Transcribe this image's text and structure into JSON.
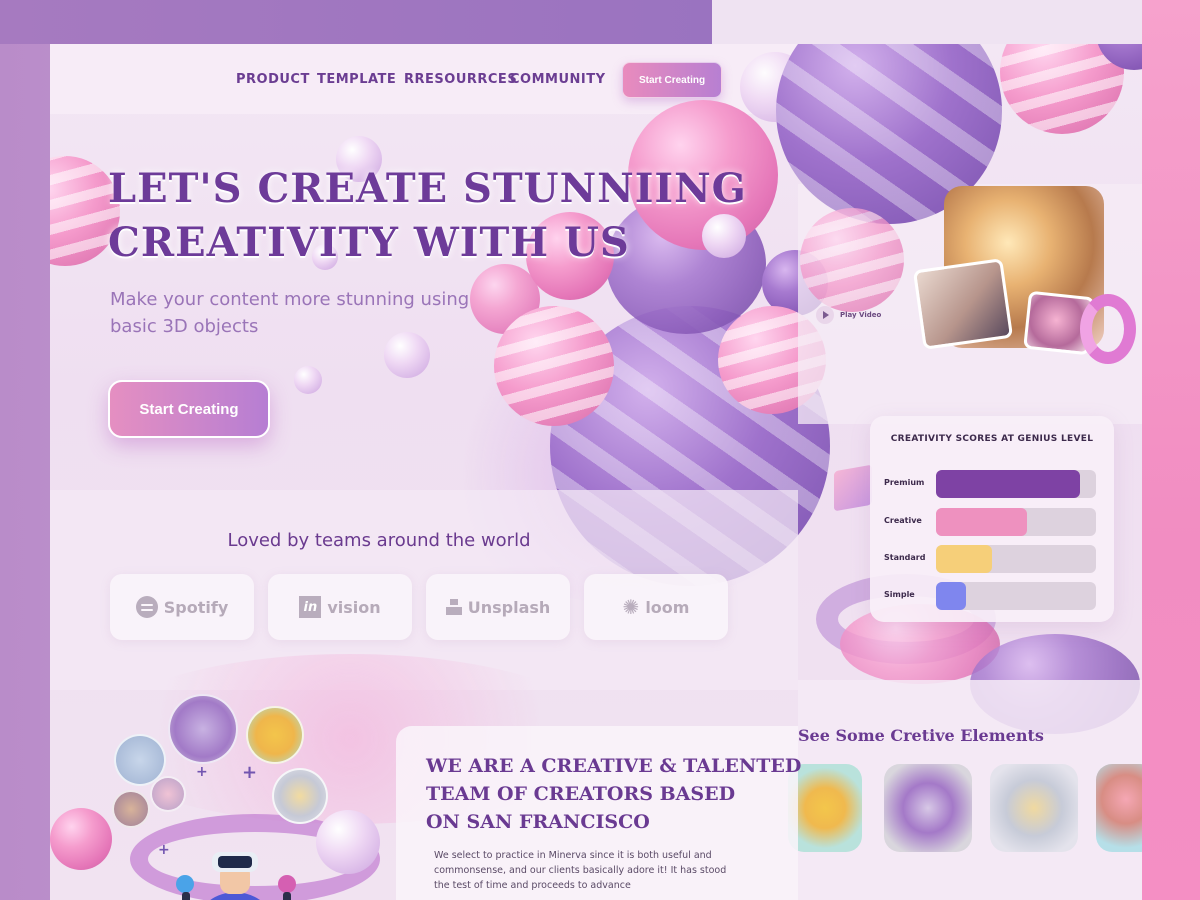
{
  "nav": {
    "items": [
      "PRODUCT",
      "TEMPLATE",
      "RRESOURRCES",
      "COMMUNITY"
    ],
    "cta": "Start Creating"
  },
  "hero": {
    "title_line1": "LET'S CREATE STUNNIING",
    "title_line2": "CREATIVITY WITH US",
    "subtitle_line1": "Make your content more stunning using",
    "subtitle_line2": "basic 3D objects",
    "cta": "Start Creating"
  },
  "video": {
    "play_label": "Play Video",
    "play_icon": "play-icon"
  },
  "logos": {
    "heading": "Loved by teams around the world",
    "items": [
      {
        "name": "Spotify",
        "icon": "spotify-icon"
      },
      {
        "name": "vision",
        "prefix": "in",
        "icon": "invision-icon"
      },
      {
        "name": "Unsplash",
        "icon": "unsplash-icon"
      },
      {
        "name": "loom",
        "icon": "loom-icon"
      }
    ]
  },
  "scores": {
    "title": "CREATIVITY SCORES AT GENIUS LEVEL",
    "rows": [
      {
        "label": "Premium",
        "value": 0.9,
        "color": "#7e42a4"
      },
      {
        "label": "Creative",
        "value": 0.57,
        "color": "#ee91bf"
      },
      {
        "label": "Standard",
        "value": 0.35,
        "color": "#f6cf79"
      },
      {
        "label": "Simple",
        "value": 0.19,
        "color": "#7f86ee"
      }
    ]
  },
  "team": {
    "title_line1": "WE ARE A CREATIVE & TALENTED",
    "title_line2": "TEAM OF   CREATORS BASED",
    "title_line3": "ON SAN FRANCISCO",
    "desc_line1": "We select to practice in Minerva since it is both useful and",
    "desc_line2": "commonsense, and our clients basically adore it! It has stood",
    "desc_line3": "the test of time and proceeds to advance"
  },
  "creative": {
    "title": "See Some Cretive Elements"
  },
  "colors": {
    "accent_purple": "#6d3b99",
    "accent_pink": "#e98bbd"
  }
}
